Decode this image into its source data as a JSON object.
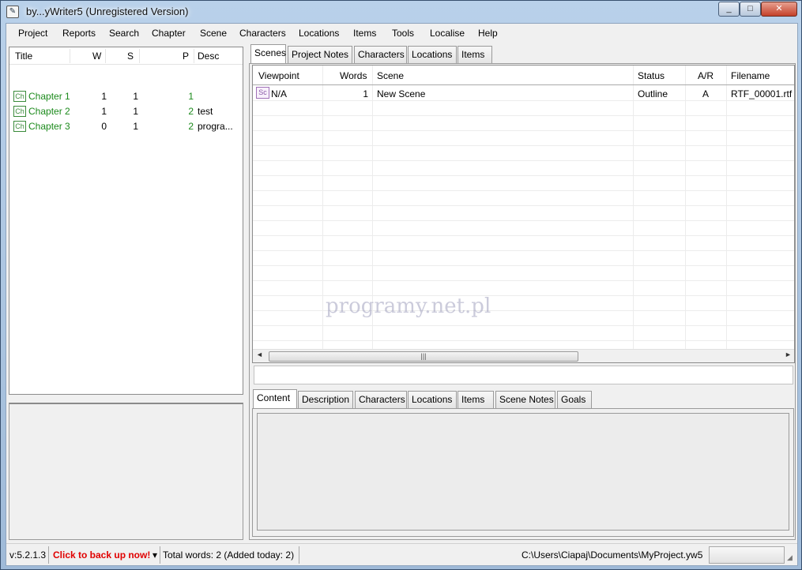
{
  "window": {
    "title": "by...yWriter5 (Unregistered Version)",
    "minimize": "_",
    "maximize": "□",
    "close": "✕"
  },
  "menu": [
    "Project",
    "Reports",
    "Search",
    "Chapter",
    "Scene",
    "Characters",
    "Locations",
    "Items",
    "Tools",
    "Localise",
    "Help"
  ],
  "chapters": {
    "headers": {
      "title": "Title",
      "w": "W",
      "s": "S",
      "p": "P",
      "desc": "Desc"
    },
    "rows": [
      {
        "icon": "Ch",
        "title": "Chapter 1",
        "w": "1",
        "s": "1",
        "p": "1",
        "desc": ""
      },
      {
        "icon": "Ch",
        "title": "Chapter 2",
        "w": "1",
        "s": "1",
        "p": "2",
        "desc": "test"
      },
      {
        "icon": "Ch",
        "title": "Chapter 3",
        "w": "0",
        "s": "1",
        "p": "2",
        "desc": "progra..."
      }
    ]
  },
  "top_tabs": [
    "Scenes",
    "Project Notes",
    "Characters",
    "Locations",
    "Items"
  ],
  "scenes": {
    "headers": {
      "viewpoint": "Viewpoint",
      "words": "Words",
      "scene": "Scene",
      "status": "Status",
      "ar": "A/R",
      "filename": "Filename"
    },
    "rows": [
      {
        "icon": "Sc",
        "viewpoint": "N/A",
        "words": "1",
        "scene": "New Scene",
        "status": "Outline",
        "ar": "A",
        "filename": "RTF_00001.rtf"
      }
    ]
  },
  "scroll": {
    "left": "◄",
    "right": "►",
    "thumb": "|||"
  },
  "bottom_tabs": [
    "Content",
    "Description",
    "Characters",
    "Locations",
    "Items",
    "Scene Notes",
    "Goals"
  ],
  "status": {
    "version": "v:5.2.1.3",
    "backup": "Click to back up now!",
    "dropdown": "▾",
    "total_words": "Total words: 2 (Added today: 2)",
    "path": "C:\\Users\\Ciapaj\\Documents\\MyProject.yw5"
  },
  "watermark": "programy.net.pl",
  "colors": {
    "chapter_green": "#1b8a1b",
    "backup_red": "#e00000",
    "scene_icon": "#8a5aa8"
  }
}
